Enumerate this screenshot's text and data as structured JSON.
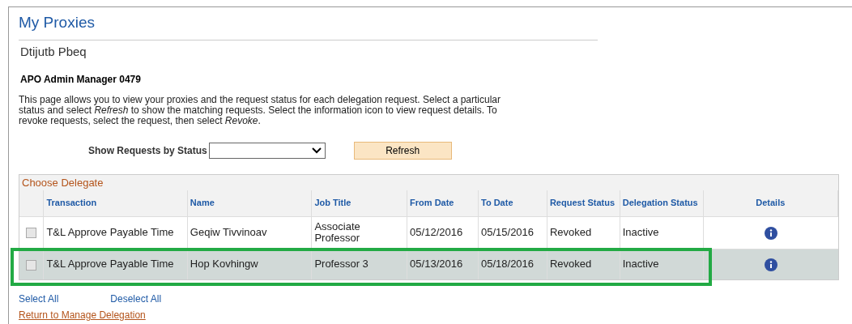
{
  "title": "My Proxies",
  "user_name": "Dtijutb Pbeq",
  "role": "APO Admin Manager 0479",
  "description": "This page allows you to view your proxies and the request status for each delegation request. Select a particular status and select *Refresh* to show the matching requests. Select the information icon to view request details. To revoke requests, select the request, then select *Revoke*.",
  "status_filter": {
    "label": "Show Requests by Status"
  },
  "refresh_button": "Refresh",
  "grid": {
    "title": "Choose Delegate",
    "columns": [
      "Transaction",
      "Name",
      "Job Title",
      "From Date",
      "To Date",
      "Request Status",
      "Delegation Status",
      "Details"
    ],
    "rows": [
      {
        "checked": false,
        "selected": false,
        "highlighted": false,
        "cells": [
          "T&L Approve Payable Time",
          "Geqiw Tivvinoav",
          "Associate Professor",
          "05/12/2016",
          "05/15/2016",
          "Revoked",
          "Inactive"
        ]
      },
      {
        "checked": false,
        "selected": true,
        "highlighted": true,
        "cells": [
          "T&L Approve Payable Time",
          "Hop Kovhingw",
          "Professor 3",
          "05/13/2016",
          "05/18/2016",
          "Revoked",
          "Inactive"
        ]
      }
    ]
  },
  "links": [
    "Select All",
    "Deselect All"
  ],
  "return_link": "Return to Manage Delegation"
}
